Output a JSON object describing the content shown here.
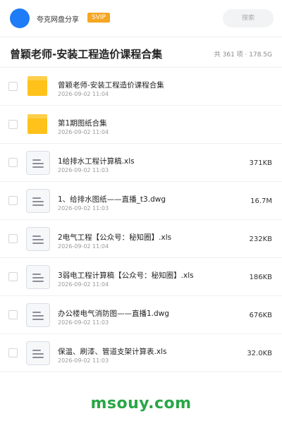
{
  "header": {
    "share_name": "夸克网盘分享",
    "badge": "SVIP",
    "search_placeholder": "搜索"
  },
  "folder_title": "曾颖老师-安装工程造价课程合集",
  "stats": "共 361 项 · 178.5G",
  "files": [
    {
      "name": "曾颖老师-安装工程造价课程合集",
      "date": "2026-09-02 11:04",
      "size": "",
      "type": "folder"
    },
    {
      "name": "第1期图纸合集",
      "date": "2026-09-02 11:04",
      "size": "",
      "type": "folder"
    },
    {
      "name": "1给排水工程计算稿.xls",
      "date": "2026-09-02 11:03",
      "size": "371KB",
      "type": "file"
    },
    {
      "name": "1、给排水图纸——直播_t3.dwg",
      "date": "2026-09-02 11:03",
      "size": "16.7M",
      "type": "file"
    },
    {
      "name": "2电气工程【公众号：秘知圈】.xls",
      "date": "2026-09-02 11:04",
      "size": "232KB",
      "type": "file"
    },
    {
      "name": "3弱电工程计算稿【公众号：秘知圈】.xls",
      "date": "2026-09-02 11:04",
      "size": "186KB",
      "type": "file"
    },
    {
      "name": "办公楼电气消防图——直播1.dwg",
      "date": "2026-09-02 11:03",
      "size": "676KB",
      "type": "file"
    },
    {
      "name": "保温、刷漆、管道支架计算表.xls",
      "date": "2026-09-02 11:03",
      "size": "32.0KB",
      "type": "file"
    }
  ],
  "watermark": "msouy.com",
  "colors": {
    "avatar": "#1e7cf7",
    "svip_badge": "#f5a623",
    "folder": "#ffc21a",
    "watermark": "#28a745"
  }
}
